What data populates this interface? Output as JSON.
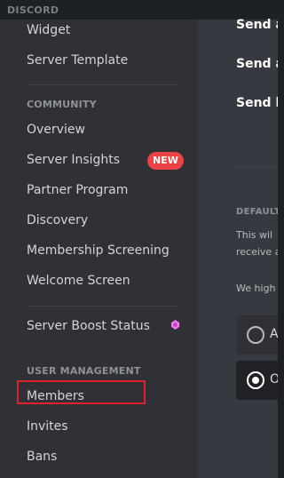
{
  "app": {
    "brand": "DISCORD"
  },
  "sidebar": {
    "items_top": [
      {
        "label": "Widget"
      },
      {
        "label": "Server Template"
      }
    ],
    "community": {
      "title": "COMMUNITY",
      "items": [
        {
          "label": "Overview"
        },
        {
          "label": "Server Insights",
          "badge": "NEW"
        },
        {
          "label": "Partner Program"
        },
        {
          "label": "Discovery"
        },
        {
          "label": "Membership Screening"
        },
        {
          "label": "Welcome Screen"
        }
      ]
    },
    "boost": {
      "label": "Server Boost Status",
      "icon": "boost-gem-icon"
    },
    "user_management": {
      "title": "USER MANAGEMENT",
      "items": [
        {
          "label": "Members",
          "highlighted": true
        },
        {
          "label": "Invites"
        },
        {
          "label": "Bans"
        }
      ]
    }
  },
  "content": {
    "rows": [
      "Send a",
      "Send a",
      "Send h"
    ],
    "section_title": "DEFAULT",
    "desc_line1": "This wil",
    "desc_line2": "receive a",
    "note": "We high",
    "options": [
      {
        "label": "A",
        "selected": false
      },
      {
        "label": "O",
        "selected": true
      }
    ]
  },
  "colors": {
    "sidebar_bg": "#2f3136",
    "content_bg": "#36393f",
    "badge": "#ed4245",
    "boost": "#ff73fa",
    "highlight_border": "#e0202a"
  }
}
